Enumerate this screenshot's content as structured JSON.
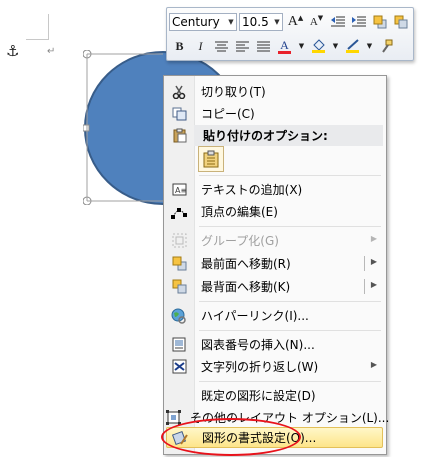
{
  "document": {
    "anchor_icon": "anchor-icon",
    "paragraph_mark": "↵",
    "shape": {
      "type": "circle",
      "fill": "#4f81bd",
      "stroke": "#385d8a"
    }
  },
  "minitoolbar": {
    "font_name": "Century",
    "font_size": "10.5",
    "buttons_row1": [
      "grow-font-icon",
      "shrink-font-icon",
      "decrease-indent-icon",
      "increase-indent-icon",
      "bring-forward-icon",
      "send-backward-icon"
    ],
    "bold": "B",
    "italic": "I",
    "font_color_letter": "A",
    "accent": {
      "font_color": "#e8212b",
      "fill_color": "#ffd700"
    }
  },
  "context_menu": {
    "items": [
      {
        "label": "切り取り(T)",
        "icon": "scissors-icon"
      },
      {
        "label": "コピー(C)",
        "icon": "copy-icon"
      },
      {
        "label": "貼り付けのオプション:",
        "icon": "paste-icon"
      },
      {
        "label": "テキストの追加(X)",
        "icon": "textbox-icon"
      },
      {
        "label": "頂点の編集(E)",
        "icon": "edit-points-icon"
      },
      {
        "label": "グループ化(G)",
        "icon": "group-icon",
        "disabled": true
      },
      {
        "label": "最前面へ移動(R)",
        "icon": "bring-to-front-icon"
      },
      {
        "label": "最背面へ移動(K)",
        "icon": "send-to-back-icon"
      },
      {
        "label": "ハイパーリンク(I)...",
        "icon": "hyperlink-globe-icon"
      },
      {
        "label": "図表番号の挿入(N)...",
        "icon": "insert-caption-icon"
      },
      {
        "label": "文字列の折り返し(W)",
        "icon": "text-wrap-icon"
      },
      {
        "label": "既定の図形に設定(D)",
        "icon": ""
      },
      {
        "label": "その他のレイアウト オプション(L)...",
        "icon": "layout-options-icon"
      },
      {
        "label": "図形の書式設定(O)...",
        "icon": "format-shape-icon"
      }
    ]
  },
  "annotation": {
    "color": "#e8121b",
    "target": "図形の書式設定(O)..."
  }
}
